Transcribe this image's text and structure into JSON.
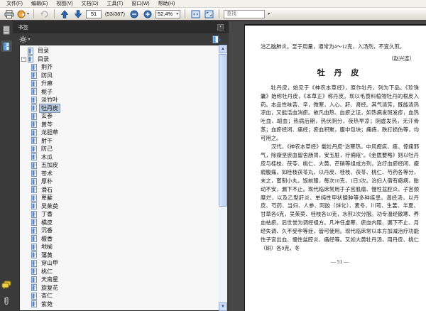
{
  "menu": {
    "items": [
      "文件(F)",
      "编辑(E)",
      "视图(V)",
      "文档(D)",
      "工具(T)",
      "窗口(W)",
      "帮助(H)"
    ]
  },
  "toolbar": {
    "page_input": "51",
    "page_count": "(53/387)",
    "zoom_value": "52.4%",
    "find_placeholder": "查找"
  },
  "sidebar": {
    "panel_title": "书签",
    "bookmarks": [
      {
        "label": "目录",
        "level": 1,
        "expanded": false,
        "selected": false
      },
      {
        "label": "目录",
        "level": 1,
        "expanded": true,
        "selected": false
      },
      {
        "label": "荆芥",
        "level": 2,
        "selected": false
      },
      {
        "label": "防风",
        "level": 2,
        "selected": false
      },
      {
        "label": "升麻",
        "level": 2,
        "selected": false
      },
      {
        "label": "栀子",
        "level": 2,
        "selected": false
      },
      {
        "label": "淡竹叶",
        "level": 2,
        "selected": false
      },
      {
        "label": "牡丹皮",
        "level": 2,
        "selected": true
      },
      {
        "label": "玄参",
        "level": 2,
        "selected": false
      },
      {
        "label": "黄芩",
        "level": 2,
        "selected": false
      },
      {
        "label": "龙胆草",
        "level": 2,
        "selected": false
      },
      {
        "label": "射干",
        "level": 2,
        "selected": false
      },
      {
        "label": "防己",
        "level": 2,
        "selected": false
      },
      {
        "label": "木瓜",
        "level": 2,
        "selected": false
      },
      {
        "label": "五加皮",
        "level": 2,
        "selected": false
      },
      {
        "label": "苍术",
        "level": 2,
        "selected": false
      },
      {
        "label": "厚朴",
        "level": 2,
        "selected": false
      },
      {
        "label": "滑石",
        "level": 2,
        "selected": false
      },
      {
        "label": "萆薢",
        "level": 2,
        "selected": false
      },
      {
        "label": "吴茱萸",
        "level": 2,
        "selected": false
      },
      {
        "label": "丁香",
        "level": 2,
        "selected": false
      },
      {
        "label": "橘皮",
        "level": 2,
        "selected": false
      },
      {
        "label": "沉香",
        "level": 2,
        "selected": false
      },
      {
        "label": "檀香",
        "level": 2,
        "selected": false
      },
      {
        "label": "地榆",
        "level": 2,
        "selected": false
      },
      {
        "label": "蒲黄",
        "level": 2,
        "selected": false
      },
      {
        "label": "穿山甲",
        "level": 2,
        "selected": false
      },
      {
        "label": "桃仁",
        "level": 2,
        "selected": false
      },
      {
        "label": "天南星",
        "level": 2,
        "selected": false
      },
      {
        "label": "旋复花",
        "level": 2,
        "selected": false
      },
      {
        "label": "杏仁",
        "level": 2,
        "selected": false
      },
      {
        "label": "紫菀",
        "level": 2,
        "selected": false
      }
    ]
  },
  "document": {
    "continuation": "治乙脑肺炎。至于用量，通常为4～12克，入汤剂，不宜久煎。",
    "attribution": "（赵兴连）",
    "title": "牡 丹 皮",
    "paragraphs": [
      "牡丹皮，始见于《神农本草经》，原作牡丹，列为下品。《珍珠囊》始称牡丹皮，《本草正》称丹皮。现以毛茛科植物牡丹的根皮入药。本品性味苦、辛，微寒，入心、肝、肾经。其气清芳，既能清热凉血，又能活血消瘀。故凡血热、血瘀之证，如热病发斑发疹，血热吐血、衄血；热病后期，热伏阴分，夜热早凉；阴虚发热，无汗骨蒸；血瘀经闭、痛经；瘀血积聚，腹中包块；痈疡，跌打损伤等，均可用之。",
      "汉代，《神农本草经》载牡丹皮“治寒热，中风瘛疭、痉、惊痫邪气，除癥坚瘀血留舍肠胃，安五脏，疗痈疮”。《金匮要略》则以牡丹皮与桂枝、茯苓、桃仁、大黄、芒硝等组成方剂，治疗血瘀经闭、癥瘕腹痛，如桂枝茯苓丸，以丹皮、桂枝、茯苓、桃仁、芍药各等分，末之，蜜制小丸，饭前服，每次10克，1日3次。治妇人宿有癥病，胎动不安，漏下不止。现代临床常用于子宫肌瘤、慢性盆腔炎、子宫颈糜烂，以及乙型肝炎、单纯性甲状腺肿等多种疾患。温经汤，以丹皮、芍药、当归、人参、阿胶（烊化）、麦冬、川芎、生姜、半夏、甘草各6克，吴茱萸、桂枝各10克，水煎2次分服。功专温经散寒、养血祛瘀。后世誉为调经祖方。凡冲任虚寒、瘀血内阻、漏下不止、月经失调、久不受孕等症，皆可使用。现代临床常以本方加减治疗功能性子宫出血、慢性盆腔炎、痛经等。又如大黄牡丹汤，用丹皮、桃仁（研）各9克，冬"
    ],
    "page_number_footer": "— 51 —"
  },
  "colors": {
    "selection_highlight": "#b8c8de",
    "nav_arrow_blue": "#2a62a8",
    "panel_dark": "#3a3a3a",
    "page_bg": "#ffffff"
  }
}
